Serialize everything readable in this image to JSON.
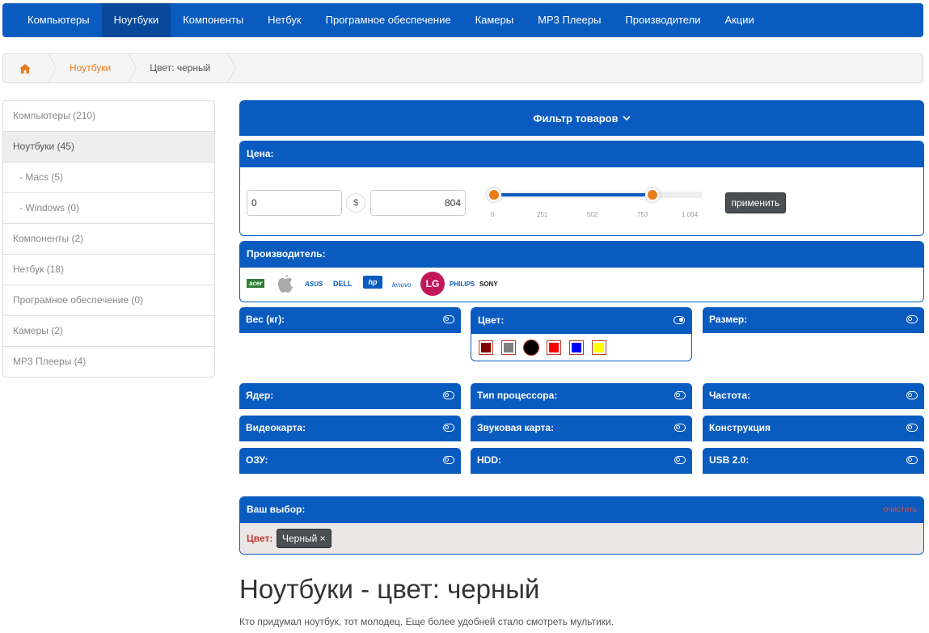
{
  "nav": {
    "items": [
      "Компьютеры",
      "Ноутбуки",
      "Компоненты",
      "Нетбук",
      "Програмное обеспечение",
      "Камеры",
      "MP3 Плееры",
      "Производители",
      "Акции"
    ],
    "active_index": 1
  },
  "breadcrumb": {
    "home_icon": "home-icon",
    "items": [
      "Ноутбуки",
      "Цвет: черный"
    ]
  },
  "sidebar": {
    "items": [
      {
        "label": "Компьютеры (210)"
      },
      {
        "label": "Ноутбуки (45)",
        "active": true
      },
      {
        "label": "- Macs (5)"
      },
      {
        "label": "- Windows (0)"
      },
      {
        "label": "Компоненты (2)"
      },
      {
        "label": "Нетбук (18)"
      },
      {
        "label": "Програмное обеспечение (0)"
      },
      {
        "label": "Камеры (2)"
      },
      {
        "label": "MP3 Плееры (4)"
      }
    ]
  },
  "filter": {
    "title": "Фильтр товаров",
    "price": {
      "label": "Цена:",
      "min": "0",
      "max": "804",
      "currency": "$",
      "ticks": [
        "0",
        "251",
        "502",
        "753",
        "1 004"
      ],
      "apply_label": "применить"
    },
    "manufacturer": {
      "label": "Производитель:",
      "brands": [
        "acer",
        "apple",
        "ASUS",
        "DELL",
        "hp",
        "lenovo",
        "LG",
        "PHILIPS",
        "SONY"
      ]
    },
    "weight": {
      "label": "Вес (кг):"
    },
    "color": {
      "label": "Цвет:",
      "swatches": [
        "#800000",
        "#808080",
        "#000000",
        "#ff0000",
        "#0000ff",
        "#ffff00"
      ]
    },
    "size": {
      "label": "Размер:"
    },
    "cores": {
      "label": "Ядер:"
    },
    "cpu_type": {
      "label": "Тип процессора:"
    },
    "frequency": {
      "label": "Частота:"
    },
    "video": {
      "label": "Видеокарта:"
    },
    "sound": {
      "label": "Звуковая карта:"
    },
    "construction": {
      "label": "Конструкция"
    },
    "ram": {
      "label": "ОЗУ:"
    },
    "hdd": {
      "label": "HDD:"
    },
    "usb": {
      "label": "USB 2.0:"
    }
  },
  "selection": {
    "label": "Ваш выбор:",
    "clear_label": "очистить",
    "group_label": "Цвет:",
    "tag_label": "Черный ×"
  },
  "page": {
    "title": "Ноутбуки - цвет: черный",
    "description": "Кто придумал ноутбук, тот молодец. Еще более удобней стало смотреть мультики."
  },
  "colors": {
    "primary": "#0a5bbf",
    "accent": "#e87e1c",
    "clear": "#e74c3c"
  }
}
